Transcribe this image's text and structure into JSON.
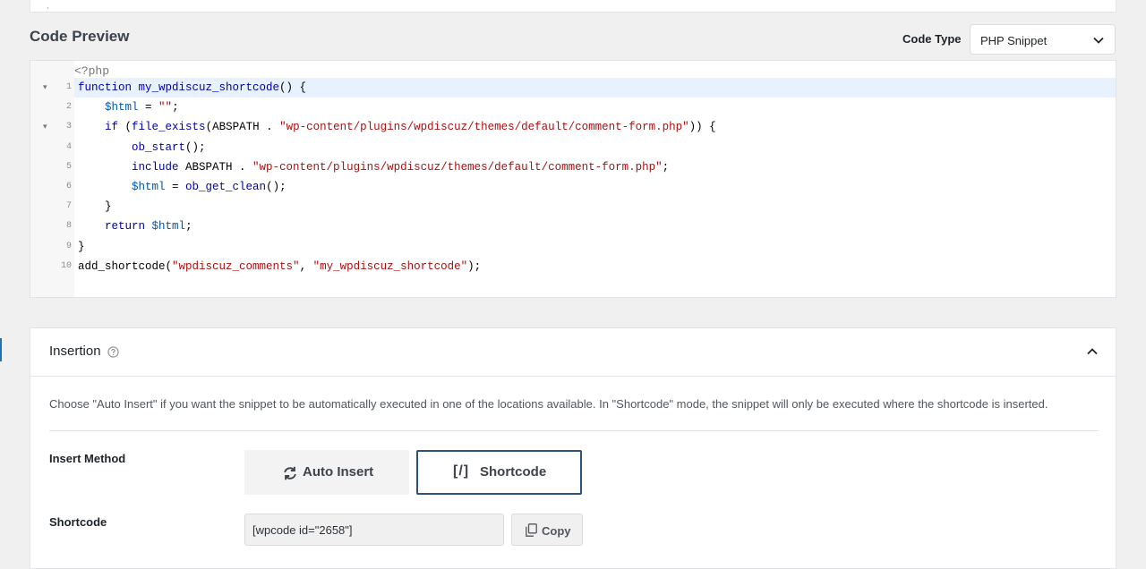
{
  "top_card": {
    "tick_text": ","
  },
  "code_preview": {
    "title": "Code Preview",
    "code_type_label": "Code Type",
    "code_type_value": "PHP Snippet",
    "php_open_tag": "<?php",
    "lines": [
      {
        "num": "1",
        "fold": true,
        "tokens": [
          {
            "t": "function ",
            "c": "kw"
          },
          {
            "t": "my_wpdiscuz_shortcode",
            "c": "kw"
          },
          {
            "t": "() {",
            "c": ""
          }
        ]
      },
      {
        "num": "2",
        "fold": false,
        "tokens": [
          {
            "t": "    ",
            "c": ""
          },
          {
            "t": "$html",
            "c": "vr"
          },
          {
            "t": " = ",
            "c": ""
          },
          {
            "t": "\"\"",
            "c": "st"
          },
          {
            "t": ";",
            "c": ""
          }
        ]
      },
      {
        "num": "3",
        "fold": true,
        "tokens": [
          {
            "t": "    ",
            "c": ""
          },
          {
            "t": "if",
            "c": "kw"
          },
          {
            "t": " (",
            "c": ""
          },
          {
            "t": "file_exists",
            "c": "kw"
          },
          {
            "t": "(ABSPATH . ",
            "c": ""
          },
          {
            "t": "\"wp-content/plugins/wpdiscuz/themes/default/comment-form.php\"",
            "c": "st"
          },
          {
            "t": ")) {",
            "c": ""
          }
        ]
      },
      {
        "num": "4",
        "fold": false,
        "tokens": [
          {
            "t": "        ",
            "c": ""
          },
          {
            "t": "ob_start",
            "c": "kw"
          },
          {
            "t": "();",
            "c": ""
          }
        ]
      },
      {
        "num": "5",
        "fold": false,
        "tokens": [
          {
            "t": "        ",
            "c": ""
          },
          {
            "t": "include",
            "c": "kw"
          },
          {
            "t": " ABSPATH . ",
            "c": ""
          },
          {
            "t": "\"wp-content/plugins/wpdiscuz/themes/default/comment-form.php\"",
            "c": "st"
          },
          {
            "t": ";",
            "c": ""
          }
        ]
      },
      {
        "num": "6",
        "fold": false,
        "tokens": [
          {
            "t": "        ",
            "c": ""
          },
          {
            "t": "$html",
            "c": "vr"
          },
          {
            "t": " = ",
            "c": ""
          },
          {
            "t": "ob_get_clean",
            "c": "kw"
          },
          {
            "t": "();",
            "c": ""
          }
        ]
      },
      {
        "num": "7",
        "fold": false,
        "tokens": [
          {
            "t": "    }",
            "c": ""
          }
        ]
      },
      {
        "num": "8",
        "fold": false,
        "tokens": [
          {
            "t": "    ",
            "c": ""
          },
          {
            "t": "return",
            "c": "kw"
          },
          {
            "t": " ",
            "c": ""
          },
          {
            "t": "$html",
            "c": "vr"
          },
          {
            "t": ";",
            "c": ""
          }
        ]
      },
      {
        "num": "9",
        "fold": false,
        "tokens": [
          {
            "t": "}",
            "c": ""
          }
        ]
      },
      {
        "num": "10",
        "fold": false,
        "tokens": [
          {
            "t": "add_shortcode(",
            "c": ""
          },
          {
            "t": "\"wpdiscuz_comments\"",
            "c": "st"
          },
          {
            "t": ", ",
            "c": ""
          },
          {
            "t": "\"my_wpdiscuz_shortcode\"",
            "c": "st"
          },
          {
            "t": ");",
            "c": ""
          }
        ]
      }
    ]
  },
  "insertion": {
    "title": "Insertion",
    "description": "Choose \"Auto Insert\" if you want the snippet to be automatically executed in one of the locations available. In \"Shortcode\" mode, the snippet will only be executed where the shortcode is inserted.",
    "insert_method_label": "Insert Method",
    "auto_insert_label": "Auto Insert",
    "shortcode_symbol": "[/]",
    "shortcode_label": "Shortcode",
    "selected_method": "Shortcode",
    "shortcode_field_label": "Shortcode",
    "shortcode_value": "[wpcode id=\"2658\"]",
    "copy_label": "Copy"
  },
  "colors": {
    "accent": "#2c5282",
    "keyword": "#0000aa",
    "variable": "#0055aa",
    "string": "#aa1111",
    "active_line": "#e8f2ff"
  },
  "icons": {
    "select_arrow": "chevron-down-icon",
    "help": "help-circle-icon",
    "collapse": "chevron-up-icon",
    "auto_insert": "refresh-icon",
    "copy": "copy-icon"
  }
}
